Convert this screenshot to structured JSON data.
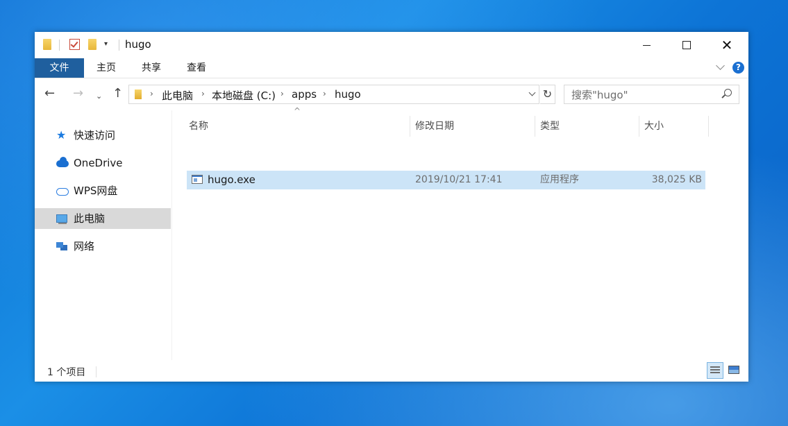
{
  "window": {
    "title": "hugo",
    "controls": {
      "minimize": "minimize-icon",
      "maximize": "maximize-icon",
      "close": "✕"
    }
  },
  "ribbon": {
    "tabs": [
      {
        "label": "文件",
        "active": true
      },
      {
        "label": "主页"
      },
      {
        "label": "共享"
      },
      {
        "label": "查看"
      }
    ],
    "help": "?"
  },
  "navigation": {
    "back": "←",
    "forward": "→",
    "recent": "⌄",
    "up": "↑",
    "refresh": "↻",
    "breadcrumbs": [
      "此电脑",
      "本地磁盘 (C:)",
      "apps",
      "hugo"
    ],
    "separator": "›"
  },
  "search": {
    "placeholder": "搜索\"hugo\""
  },
  "sidebar": {
    "items": [
      {
        "label": "快速访问",
        "icon": "star-icon"
      },
      {
        "label": "OneDrive",
        "icon": "cloud-icon"
      },
      {
        "label": "WPS网盘",
        "icon": "wps-cloud-icon"
      },
      {
        "label": "此电脑",
        "icon": "computer-icon",
        "selected": true
      },
      {
        "label": "网络",
        "icon": "network-icon"
      }
    ]
  },
  "columns": {
    "name": "名称",
    "modified": "修改日期",
    "type": "类型",
    "size": "大小",
    "sort_indicator": "^"
  },
  "files": [
    {
      "name": "hugo.exe",
      "modified": "2019/10/21 17:41",
      "type": "应用程序",
      "size": "38,025 KB",
      "icon": "exe-icon"
    }
  ],
  "status": {
    "count": "1 个项目"
  },
  "colors": {
    "accent": "#1f5f9e",
    "selection": "#cce4f7",
    "sidebar_selected": "#d9d9d9",
    "desktop": "#0d74d6"
  }
}
